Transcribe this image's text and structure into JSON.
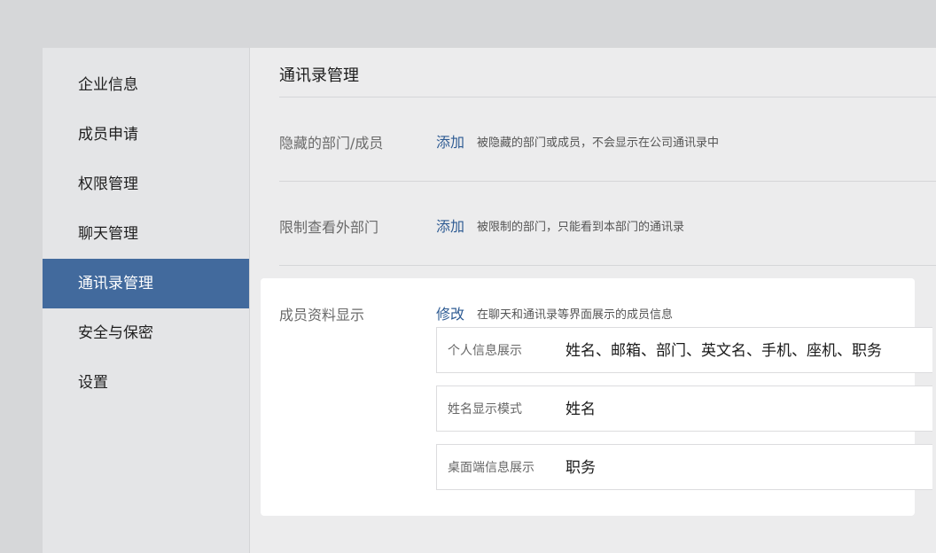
{
  "sidebar": {
    "items": [
      {
        "label": "企业信息"
      },
      {
        "label": "成员申请"
      },
      {
        "label": "权限管理"
      },
      {
        "label": "聊天管理"
      },
      {
        "label": "通讯录管理"
      },
      {
        "label": "安全与保密"
      },
      {
        "label": "设置"
      }
    ],
    "active_index": 4
  },
  "main": {
    "title": "通讯录管理",
    "hidden_row": {
      "label": "隐藏的部门/成员",
      "action": "添加",
      "desc": "被隐藏的部门或成员，不会显示在公司通讯录中"
    },
    "restrict_row": {
      "label": "限制查看外部门",
      "action": "添加",
      "desc": "被限制的部门，只能看到本部门的通讯录"
    },
    "profile_row": {
      "label": "成员资料显示",
      "action": "修改",
      "desc": "在聊天和通讯录等界面展示的成员信息",
      "fields": [
        {
          "key": "个人信息展示",
          "value": "姓名、邮箱、部门、英文名、手机、座机、职务"
        },
        {
          "key": "姓名显示模式",
          "value": "姓名"
        },
        {
          "key": "桌面端信息展示",
          "value": "职务"
        }
      ]
    }
  },
  "colors": {
    "accent": "#426a9d",
    "link": "#2e5b93"
  }
}
